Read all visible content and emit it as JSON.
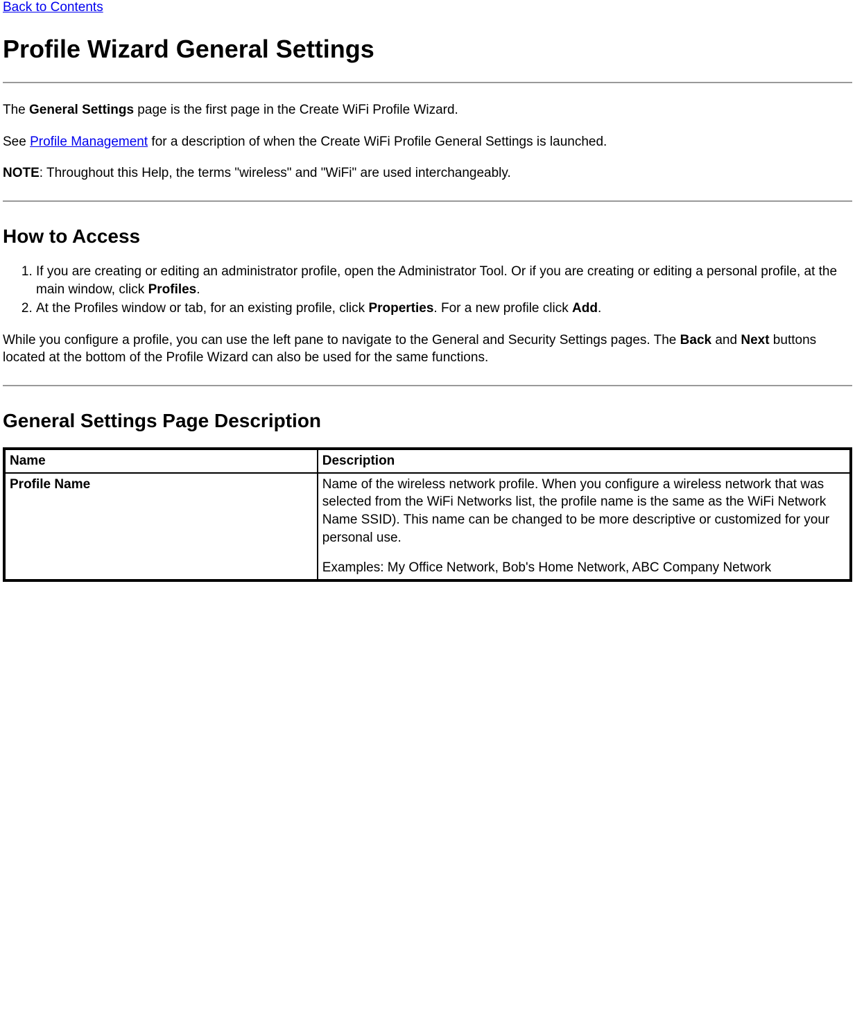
{
  "nav": {
    "back_link": "Back to Contents"
  },
  "title": "Profile Wizard General Settings",
  "intro": {
    "p1_pre": "The ",
    "p1_b": "General Settings",
    "p1_post": " page is the first page in the Create WiFi Profile Wizard.",
    "p2_pre": "See ",
    "p2_link": "Profile Management",
    "p2_post": " for a description of when the Create WiFi Profile General Settings is launched.",
    "note_b": "NOTE",
    "note_post": ": Throughout this Help, the terms \"wireless\" and \"WiFi\" are used interchangeably."
  },
  "access": {
    "heading": "How to Access",
    "li1_pre": "If you are creating or editing an administrator profile, open the Administrator Tool. Or if you are creating or editing a personal profile, at the main window, click ",
    "li1_b": "Profiles",
    "li1_post": ".",
    "li2_pre": "At the Profiles window or tab, for an existing profile, click ",
    "li2_b1": "Properties",
    "li2_mid": ". For a new profile click ",
    "li2_b2": "Add",
    "li2_post": ".",
    "nav_p_pre": "While you configure a profile, you can use the left pane to navigate to the General and Security Settings pages. The ",
    "nav_b1": "Back",
    "nav_mid": " and ",
    "nav_b2": "Next",
    "nav_post": " buttons located at the bottom of the Profile Wizard can also be used for the same functions."
  },
  "desc": {
    "heading": "General Settings Page Description",
    "header_name": "Name",
    "header_desc": "Description",
    "row1_name": "Profile Name",
    "row1_desc_p1": "Name of the wireless network profile. When you configure a wireless network that was selected from the WiFi Networks list, the profile name is the same as the WiFi Network Name SSID). This name can be changed to be more descriptive or customized for your personal use.",
    "row1_desc_p2": "Examples: My Office Network, Bob's Home Network, ABC Company Network"
  }
}
